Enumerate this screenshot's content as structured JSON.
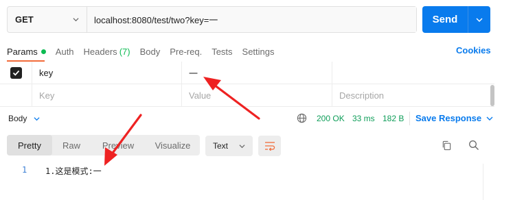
{
  "request": {
    "method": "GET",
    "url": "localhost:8080/test/two?key=一",
    "send_label": "Send"
  },
  "tabs": [
    {
      "label": "Params",
      "active": true,
      "dot": true
    },
    {
      "label": "Auth"
    },
    {
      "label": "Headers",
      "count": "(7)"
    },
    {
      "label": "Body"
    },
    {
      "label": "Pre-req."
    },
    {
      "label": "Tests"
    },
    {
      "label": "Settings"
    }
  ],
  "cookies_label": "Cookies",
  "params": {
    "rows": [
      {
        "checked": true,
        "key": "key",
        "value": "一",
        "description": ""
      }
    ],
    "placeholder": {
      "key": "Key",
      "value": "Value",
      "description": "Description"
    }
  },
  "response": {
    "body_label": "Body",
    "status": "200 OK",
    "time": "33 ms",
    "size": "182 B",
    "save_label": "Save Response",
    "view_tabs": [
      "Pretty",
      "Raw",
      "Preview",
      "Visualize"
    ],
    "active_view": "Pretty",
    "format": "Text",
    "lines": [
      {
        "number": "1",
        "text": "1.这是模式:一"
      }
    ]
  },
  "colors": {
    "accent": "#097bed",
    "success": "#0d9d58",
    "tab_underline": "#f26b3a",
    "annotation": "#ee2222"
  },
  "icons": [
    "chevron-down-icon",
    "checkbox-checked-icon",
    "globe-icon",
    "wrap-lines-icon",
    "copy-icon",
    "search-icon"
  ]
}
